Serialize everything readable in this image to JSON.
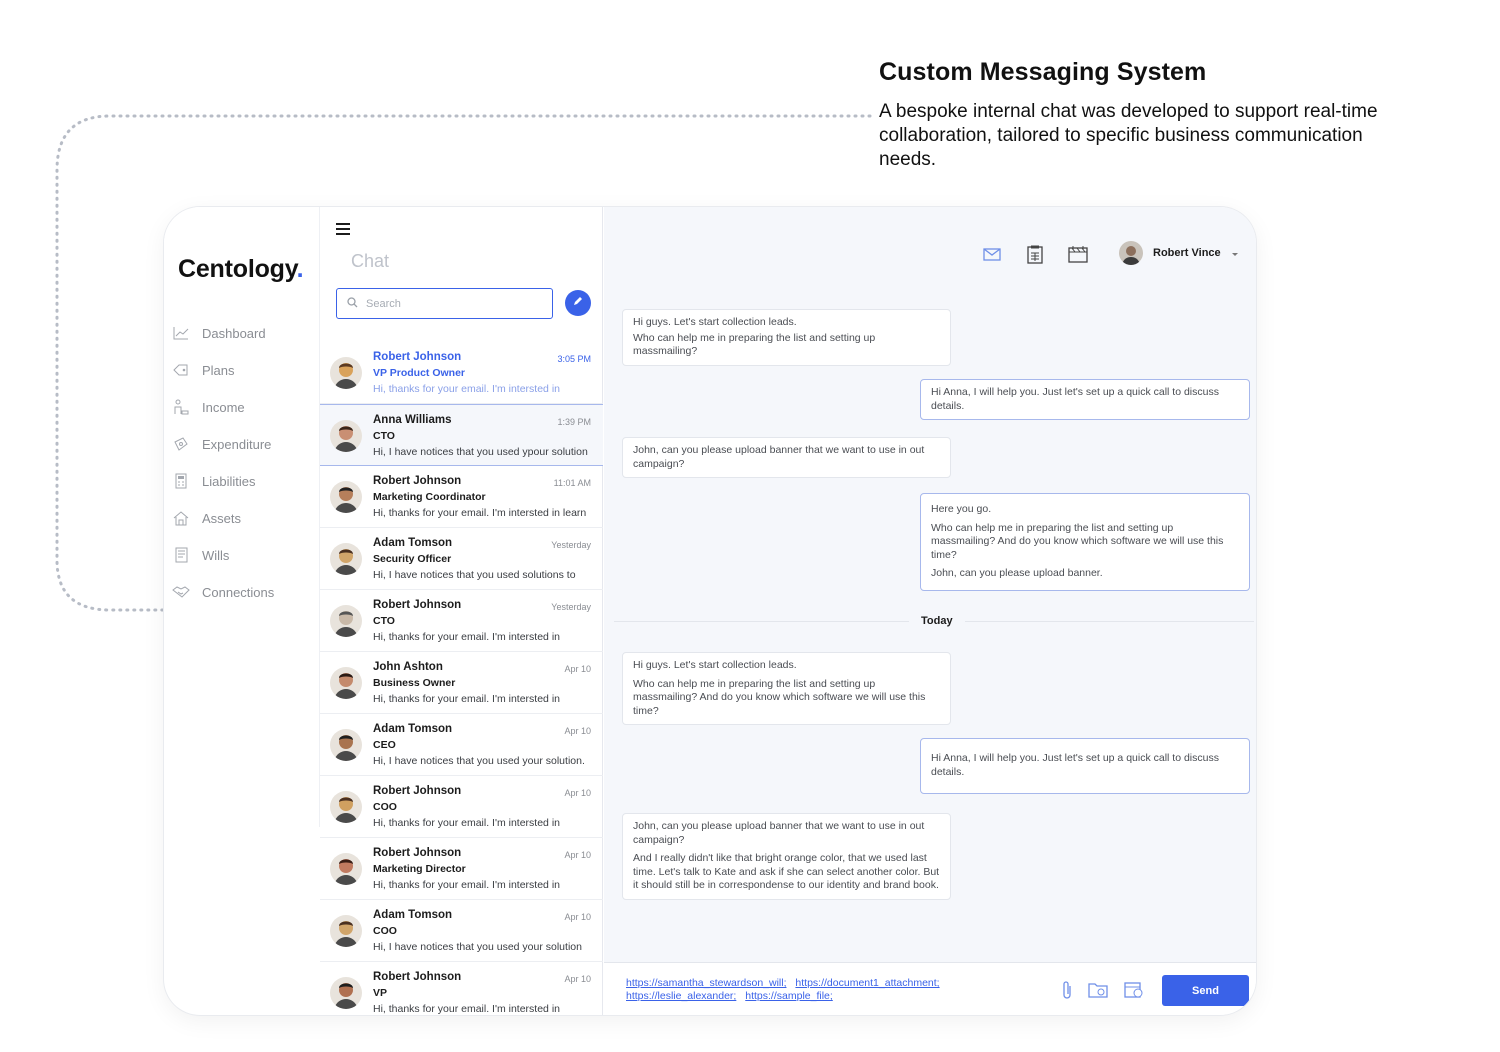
{
  "headline": {
    "title": "Custom Messaging System",
    "description": "A bespoke internal chat was developed to support real-time collaboration, tailored to specific business communication needs."
  },
  "app": {
    "logo": "Centology",
    "logo_dot": ".",
    "accent_color": "#3a62e8"
  },
  "nav": {
    "items": [
      {
        "label": "Dashboard",
        "icon": "chart-icon"
      },
      {
        "label": "Plans",
        "icon": "tag-icon"
      },
      {
        "label": "Income",
        "icon": "income-icon"
      },
      {
        "label": "Expenditure",
        "icon": "wallet-icon"
      },
      {
        "label": "Liabilities",
        "icon": "calculator-icon"
      },
      {
        "label": "Assets",
        "icon": "house-icon"
      },
      {
        "label": "Wills",
        "icon": "document-icon"
      },
      {
        "label": "Connections",
        "icon": "handshake-icon"
      }
    ]
  },
  "chat_list": {
    "title": "Chat",
    "search_placeholder": "Search",
    "conversations": [
      {
        "name": "Robert Johnson",
        "role": "VP Product Owner",
        "preview": "Hi, thanks for your email. I'm intersted in",
        "time": "3:05 PM"
      },
      {
        "name": "Anna Williams",
        "role": "CTO",
        "preview": "Hi, I have notices that you used ypour solution",
        "time": "1:39 PM"
      },
      {
        "name": "Robert Johnson",
        "role": "Marketing Coordinator",
        "preview": "Hi, thanks for your email. I'm intersted in learn",
        "time": "11:01 AM"
      },
      {
        "name": "Adam Tomson",
        "role": "Security Officer",
        "preview": "Hi, I have notices that you used solutions to",
        "time": "Yesterday"
      },
      {
        "name": "Robert Johnson",
        "role": "CTO",
        "preview": "Hi, thanks for your email. I'm intersted in",
        "time": "Yesterday"
      },
      {
        "name": "John Ashton",
        "role": "Business Owner",
        "preview": "Hi, thanks for your email. I'm intersted in",
        "time": "Apr 10"
      },
      {
        "name": "Adam Tomson",
        "role": "CEO",
        "preview": "Hi, I have notices that you used your solution.",
        "time": "Apr 10"
      },
      {
        "name": "Robert Johnson",
        "role": "COO",
        "preview": "Hi, thanks for your email. I'm intersted in",
        "time": "Apr 10"
      },
      {
        "name": "Robert Johnson",
        "role": "Marketing Director",
        "preview": "Hi, thanks for your email. I'm intersted in",
        "time": "Apr 10"
      },
      {
        "name": "Adam Tomson",
        "role": "COO",
        "preview": "Hi, I have notices that you used your solution",
        "time": "Apr 10"
      },
      {
        "name": "Robert Johnson",
        "role": "VP",
        "preview": "Hi, thanks for your email. I'm intersted in",
        "time": "Apr 10"
      }
    ]
  },
  "header": {
    "user_name": "Robert Vince",
    "icons": [
      "mail-icon",
      "clipboard-icon",
      "calendar-icon"
    ]
  },
  "messages": {
    "m1": [
      "Hi guys. Let's start collection leads.",
      "Who can help me in preparing the list and setting up massmailing?"
    ],
    "m2": [
      "Hi Anna, I will help you. Just let's set up a quick call to discuss details."
    ],
    "m3": [
      "John, can you please upload banner that we want to use in out campaign?"
    ],
    "m4": [
      "Here you go.",
      "Who can help me in preparing the list and setting up massmailing? And do you know which software we will use this time?",
      "John, can you please upload banner."
    ],
    "divider": "Today",
    "m5": [
      "Hi guys. Let's start collection leads.",
      "Who can help me in preparing the list and setting up massmailing? And do you know which software we will use this time?"
    ],
    "m6": [
      "Hi Anna, I will help you. Just let's set up a quick call to discuss details."
    ],
    "m7": [
      "John, can you please upload banner that we want to use in out campaign?",
      "And I really didn't like that bright orange color, that we used last time. Let's talk to Kate and ask if she can select another color. But it should still be in correspondense to our identity and brand book."
    ]
  },
  "composer": {
    "links": [
      "https://samantha_stewardson_will;",
      "https://document1_attachment;",
      "https://leslie_alexander;",
      "https://sample_file;"
    ],
    "send_label": "Send"
  }
}
